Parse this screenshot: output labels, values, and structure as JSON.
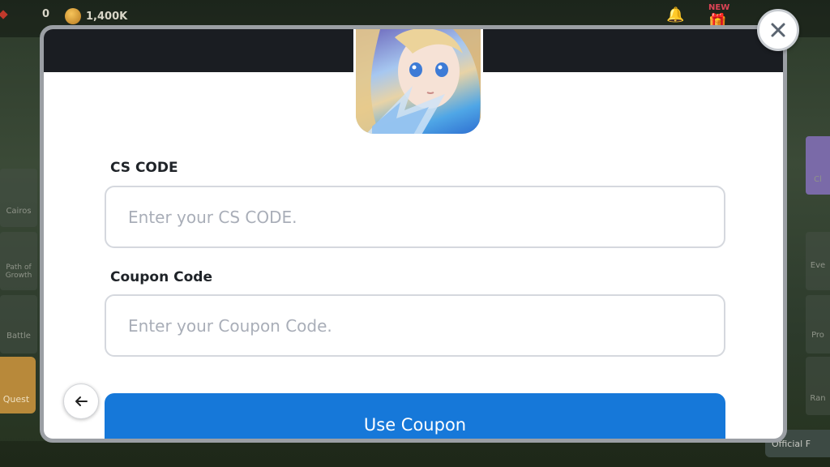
{
  "background": {
    "currency": [
      {
        "icon": "gem-icon",
        "value": "0"
      },
      {
        "icon": "coin-icon",
        "value": "1,400K"
      }
    ],
    "badge_new": "NEW",
    "left_menu": [
      {
        "label": "Cairos"
      },
      {
        "label": "Path of Growth"
      },
      {
        "label": "Battle"
      },
      {
        "label": "Quest"
      }
    ],
    "right_menu": [
      {
        "label": "Cl"
      },
      {
        "label": "Eve"
      },
      {
        "label": "Pro"
      },
      {
        "label": "Ran"
      }
    ],
    "official_tag": "Official F"
  },
  "modal": {
    "cs_code": {
      "label": "CS CODE",
      "placeholder": "Enter your CS CODE.",
      "value": ""
    },
    "coupon_code": {
      "label": "Coupon Code",
      "placeholder": "Enter your Coupon Code.",
      "value": ""
    },
    "submit_label": "Use Coupon",
    "icons": {
      "back": "arrow-left-icon",
      "close": "close-icon"
    }
  },
  "colors": {
    "header": "#1a1d22",
    "primary_button": "#1678d9",
    "input_border": "#d5d8de",
    "placeholder": "#a9aeb8"
  }
}
